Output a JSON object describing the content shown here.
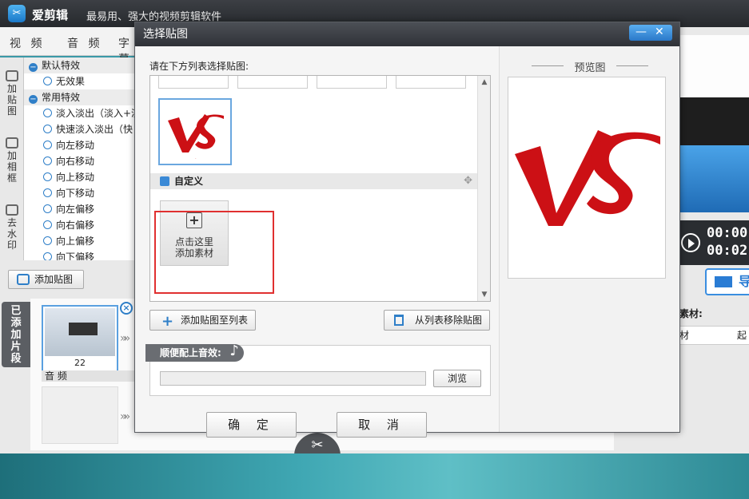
{
  "app": {
    "name": "爱剪辑",
    "slogan": "最易用、强大的视频剪辑软件",
    "logo_glyph": "✂"
  },
  "main_tabs": [
    "视 频",
    "音 频",
    "字幕"
  ],
  "vertical_tabs": [
    {
      "label": "加贴图",
      "icon": "sticker-icon"
    },
    {
      "label": "加相框",
      "icon": "frame-icon"
    },
    {
      "label": "去水印",
      "icon": "watermark-icon"
    }
  ],
  "effects": {
    "groups": [
      {
        "label": "默认特效",
        "items": [
          "无效果"
        ]
      },
      {
        "label": "常用特效",
        "items": [
          "淡入淡出（淡入+淡",
          "快速淡入淡出（快",
          "向左移动",
          "向右移动",
          "向上移动",
          "向下移动",
          "向左偏移",
          "向右偏移",
          "向上偏移",
          "向下偏移"
        ]
      }
    ]
  },
  "bottom": {
    "add_sticker_label": "添加贴图",
    "clips_label": "已添加片段",
    "clip_number": "22",
    "audio_label": "音 频",
    "close_glyph": "×",
    "arrows_glyph": "»»",
    "scissor_glyph": "✂"
  },
  "right_panel": {
    "time_current": "00:00",
    "time_total": "00:02",
    "export_label": "导",
    "material_label": "素材:",
    "col1": "材",
    "col2": "起"
  },
  "dialog": {
    "title": "选择贴图",
    "min_glyph": "—",
    "close_glyph": "✕",
    "instruction": "请在下方列表选择贴图:",
    "custom_header": "自定义",
    "add_material_line1": "点击这里",
    "add_material_line2": "添加素材",
    "add_to_list_label": "添加贴图至列表",
    "remove_from_list_label": "从列表移除贴图",
    "music_tag": "顺便配上音效:",
    "browse_label": "浏览",
    "ok_label": "确 定",
    "cancel_label": "取 消",
    "preview_title": "预览图",
    "sticker_text": "VS",
    "sticker_color": "#cc1015"
  }
}
